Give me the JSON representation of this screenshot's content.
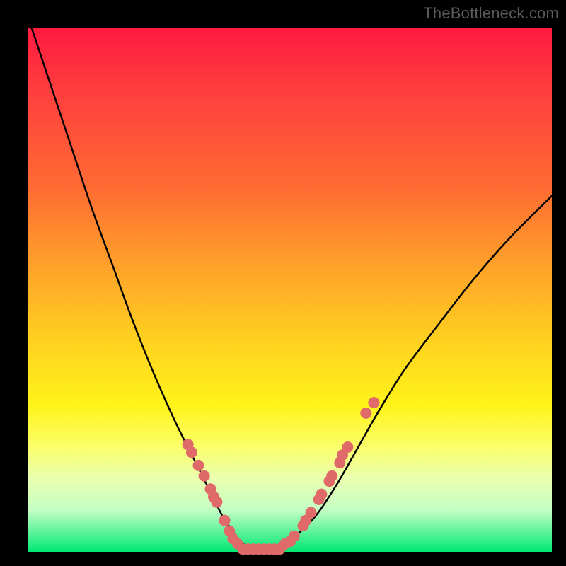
{
  "watermark": "TheBottleneck.com",
  "chart_data": {
    "type": "line",
    "title": "",
    "xlabel": "",
    "ylabel": "",
    "xlim": [
      0,
      100
    ],
    "ylim": [
      0,
      100
    ],
    "grid": false,
    "series": [
      {
        "name": "curve",
        "color": "#000000",
        "x": [
          0,
          3,
          6,
          9,
          12,
          16,
          20,
          24,
          28,
          32,
          35,
          37,
          39,
          40.5,
          42,
          43.5,
          45.5,
          48,
          51,
          55,
          59,
          63,
          67,
          72,
          78,
          85,
          92,
          100
        ],
        "y": [
          102,
          93,
          84,
          75,
          66,
          55,
          44,
          34,
          25,
          17,
          11,
          7,
          4,
          2,
          1,
          0.5,
          0.5,
          1,
          3,
          7,
          13,
          20,
          27,
          35,
          43,
          52,
          60,
          68
        ]
      }
    ],
    "markers": {
      "color": "#e06a6a",
      "radius": 8,
      "points": [
        {
          "x": 30.5,
          "y": 20.5
        },
        {
          "x": 31.2,
          "y": 19.0
        },
        {
          "x": 32.5,
          "y": 16.5
        },
        {
          "x": 33.6,
          "y": 14.5
        },
        {
          "x": 34.8,
          "y": 12.0
        },
        {
          "x": 35.4,
          "y": 10.5
        },
        {
          "x": 36.0,
          "y": 9.5
        },
        {
          "x": 37.5,
          "y": 6.0
        },
        {
          "x": 38.4,
          "y": 4.0
        },
        {
          "x": 39.1,
          "y": 2.5
        },
        {
          "x": 40.0,
          "y": 1.5
        },
        {
          "x": 41.0,
          "y": 0.5
        },
        {
          "x": 42.0,
          "y": 0.5
        },
        {
          "x": 43.0,
          "y": 0.5
        },
        {
          "x": 44.0,
          "y": 0.5
        },
        {
          "x": 45.0,
          "y": 0.5
        },
        {
          "x": 46.0,
          "y": 0.5
        },
        {
          "x": 47.0,
          "y": 0.5
        },
        {
          "x": 48.0,
          "y": 0.5
        },
        {
          "x": 49.0,
          "y": 1.5
        },
        {
          "x": 50.0,
          "y": 2.0
        },
        {
          "x": 50.8,
          "y": 3.0
        },
        {
          "x": 52.5,
          "y": 5.0
        },
        {
          "x": 53.0,
          "y": 6.0
        },
        {
          "x": 54.0,
          "y": 7.5
        },
        {
          "x": 55.5,
          "y": 10.0
        },
        {
          "x": 56.0,
          "y": 11.0
        },
        {
          "x": 57.5,
          "y": 13.5
        },
        {
          "x": 58.0,
          "y": 14.5
        },
        {
          "x": 59.5,
          "y": 17.0
        },
        {
          "x": 60.0,
          "y": 18.5
        },
        {
          "x": 61.0,
          "y": 20.0
        },
        {
          "x": 64.5,
          "y": 26.5
        },
        {
          "x": 66.0,
          "y": 28.5
        }
      ]
    }
  }
}
